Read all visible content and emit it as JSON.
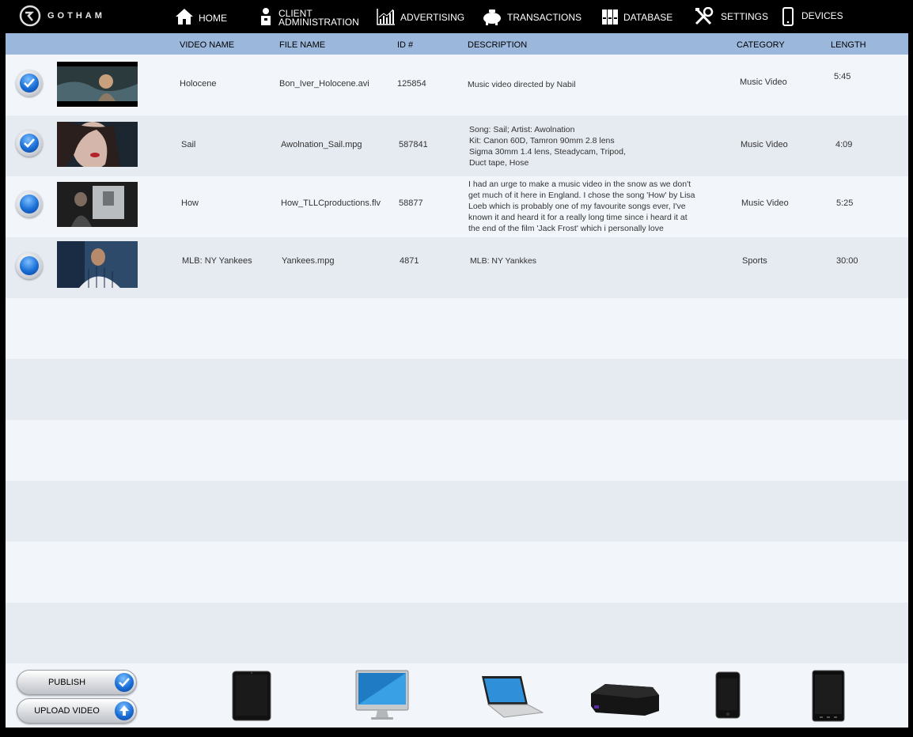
{
  "app": {
    "brand": "GOTHAM"
  },
  "nav": {
    "home": "HOME",
    "client_line1": "CLIENT",
    "client_line2": "ADMINISTRATION",
    "advertising": "ADVERTISING",
    "transactions": "TRANSACTIONS",
    "database": "DATABASE",
    "settings": "SETTINGS",
    "devices": "DEVICES"
  },
  "table": {
    "headers": {
      "video_name": "VIDEO NAME",
      "file_name": "FILE NAME",
      "id": "ID #",
      "description": "DESCRIPTION",
      "category": "CATEGORY",
      "length": "LENGTH"
    },
    "rows": [
      {
        "checked": true,
        "video_name": "Holocene",
        "file_name": "Bon_Iver_Holocene.avi",
        "id": "125854",
        "description": [
          "Music video directed by Nabil"
        ],
        "category": "Music Video",
        "length": "5:45"
      },
      {
        "checked": true,
        "video_name": "Sail",
        "file_name": "Awolnation_Sail.mpg",
        "id": "587841",
        "description": [
          "Song: Sail;  Artist: Awolnation",
          "Kit: Canon 60D, Tamron 90mm 2.8 lens",
          "Sigma 30mm 1.4 lens, Steadycam, Tripod,",
          "Duct tape, Hose"
        ],
        "category": "Music Video",
        "length": "4:09"
      },
      {
        "checked": false,
        "video_name": "How",
        "file_name": "How_TLLCproductions.flv",
        "id": "58877",
        "description": [
          "I had an urge to make a music video in the snow as we don't",
          "get much of it here in England. I chose the song 'How' by Lisa",
          "Loeb which is probably one of my favourite songs ever, I've",
          "known it and heard it for a really long time since i heard it at",
          "the end of the film 'Jack Frost' which i personally love"
        ],
        "category": "Music Video",
        "length": "5:25"
      },
      {
        "checked": false,
        "video_name": "MLB: NY Yankees",
        "file_name": "Yankees.mpg",
        "id": "4871",
        "description": [
          "MLB: NY Yankkes"
        ],
        "category": "Sports",
        "length": "30:00"
      }
    ]
  },
  "actions": {
    "publish": "PUBLISH",
    "upload": "UPLOAD VIDEO"
  },
  "colors": {
    "header": "#9bb8dc",
    "row_alt": "#e6eaf1",
    "row_plain": "#f2f6fb",
    "accent": "#1a6fd6"
  }
}
